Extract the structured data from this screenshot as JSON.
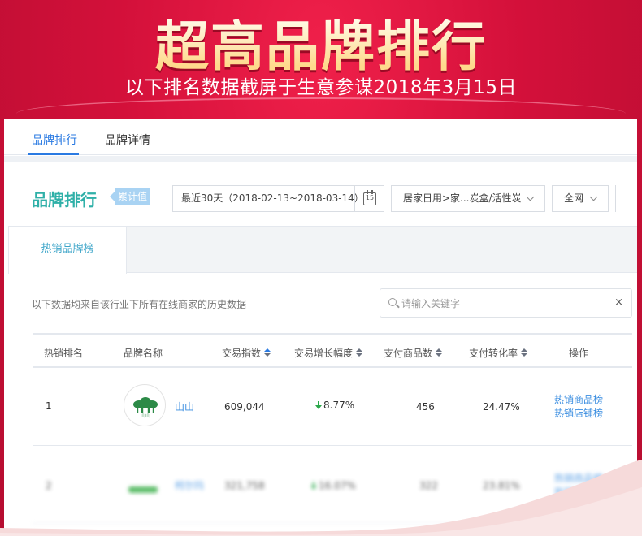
{
  "hero": {
    "title": "超高品牌排行",
    "subtitle": "以下排名数据截屏于生意参谋2018年3月15日"
  },
  "topnav": {
    "tabs": [
      {
        "label": "品牌排行",
        "active": true
      },
      {
        "label": "品牌详情",
        "active": false
      }
    ]
  },
  "section": {
    "title": "品牌排行",
    "tag": "累计值"
  },
  "filters": {
    "date_range": "最近30天（2018-02-13~2018-03-14）",
    "calendar_day": "15",
    "category": "居家日用>家...炭盒/活性炭",
    "network": "全网"
  },
  "subtab": {
    "label": "热销品牌榜"
  },
  "note": "以下数据均来自该行业下所有在线商家的历史数据",
  "search": {
    "placeholder": "请输入关键字",
    "value": "",
    "clear": "×"
  },
  "table": {
    "columns": [
      "热销排名",
      "品牌名称",
      "交易指数",
      "交易增长幅度",
      "支付商品数",
      "支付转化率",
      "操作"
    ],
    "rows": [
      {
        "rank": "1",
        "brand": "山山",
        "logo_text": "山山",
        "trade_index": "609,044",
        "growth": "8.77%",
        "growth_direction": "up",
        "items_paid": "456",
        "conversion": "24.47%",
        "actions": [
          "热销商品榜",
          "热销店铺榜"
        ]
      },
      {
        "rank": "2",
        "brand": "柯尔玛",
        "logo_text": "",
        "trade_index": "321,758",
        "growth": "16.07%",
        "growth_direction": "up",
        "items_paid": "322",
        "conversion": "23.81%",
        "actions": [
          "热销商品榜",
          "热销店铺榜"
        ]
      }
    ]
  },
  "colors": {
    "hero_bg": "#d3103a",
    "accent_blue": "#2a7ae2",
    "section_title": "#2fb0a8",
    "tag_bg": "#a9d3f3",
    "growth_up": "#2aa84a",
    "logo_green": "#2c8a47"
  }
}
